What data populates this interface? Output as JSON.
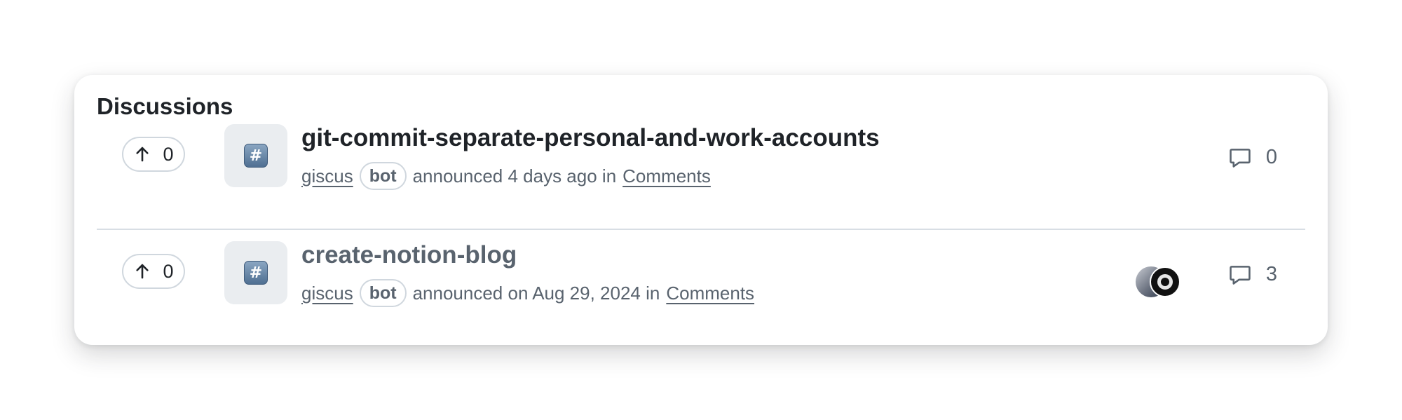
{
  "heading": "Discussions",
  "discussions": [
    {
      "upvotes": "0",
      "category_icon": "hash-emoji",
      "title": "git-commit-separate-personal-and-work-accounts",
      "author": "giscus",
      "author_badge": "bot",
      "action": "announced 4 days ago in",
      "category": "Comments",
      "comments": "0",
      "participants": []
    },
    {
      "upvotes": "0",
      "category_icon": "hash-emoji",
      "title": "create-notion-blog",
      "author": "giscus",
      "author_badge": "bot",
      "action": "announced on Aug 29, 2024 in",
      "category": "Comments",
      "comments": "3",
      "participants": [
        "participant-avatar-photo",
        "participant-avatar-dark-logo"
      ]
    }
  ],
  "colors": {
    "text_primary": "#1f2328",
    "text_muted": "#59636e",
    "border": "#d0d7de",
    "tile_bg": "#eaedf0"
  }
}
